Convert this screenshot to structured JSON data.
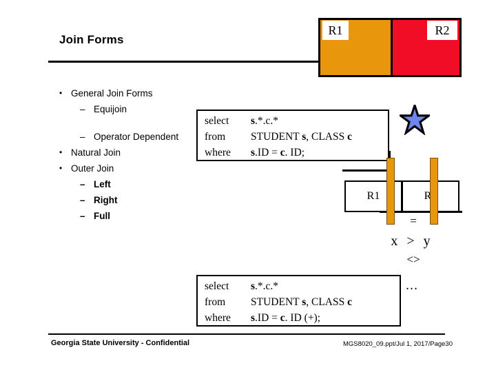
{
  "slide": {
    "title": "Join Forms",
    "header_blocks": [
      {
        "label": "R1",
        "color": "#E8960C"
      },
      {
        "label": "R2",
        "color": "#F20D27"
      }
    ],
    "bullets": [
      {
        "level": 1,
        "text": "General Join Forms",
        "bold": false
      },
      {
        "level": 2,
        "text": "Equijoin",
        "bold": false
      },
      {
        "level": 2,
        "text": "Operator Dependent",
        "bold": false
      },
      {
        "level": 1,
        "text": "Natural Join",
        "bold": false
      },
      {
        "level": 1,
        "text": "Outer Join",
        "bold": false
      },
      {
        "level": 2,
        "text": "Left",
        "bold": true
      },
      {
        "level": 2,
        "text": "Right",
        "bold": true
      },
      {
        "level": 2,
        "text": "Full",
        "bold": true
      }
    ],
    "sql_equijoin": {
      "lines": [
        {
          "keyword": "select",
          "expr": "s.*.c.*"
        },
        {
          "keyword": "from",
          "expr": "STUDENT s, CLASS c"
        },
        {
          "keyword": "where",
          "expr": "s.ID = c. ID;"
        }
      ]
    },
    "sql_outerjoin": {
      "lines": [
        {
          "keyword": "select",
          "expr": "s.*.c.*"
        },
        {
          "keyword": "from",
          "expr": "STUDENT s, CLASS c"
        },
        {
          "keyword": "where",
          "expr": "s.ID = c. ID (+);"
        }
      ]
    },
    "diagram": {
      "relation_boxes": [
        {
          "label": "R1"
        },
        {
          "label": "R2"
        }
      ],
      "operators": [
        {
          "name": "equals",
          "symbol": "="
        },
        {
          "name": "greater-than-expression",
          "symbol": "x > y"
        },
        {
          "name": "not-equals",
          "symbol": "<>"
        },
        {
          "name": "ellipsis",
          "symbol": "…"
        }
      ],
      "star_color": "#6E86EC",
      "bar_color": "#E8960C"
    },
    "footer": {
      "left": "Georgia State University - Confidential",
      "right": "MGS8020_09.ppt/Jul 1, 2017/Page30"
    }
  }
}
